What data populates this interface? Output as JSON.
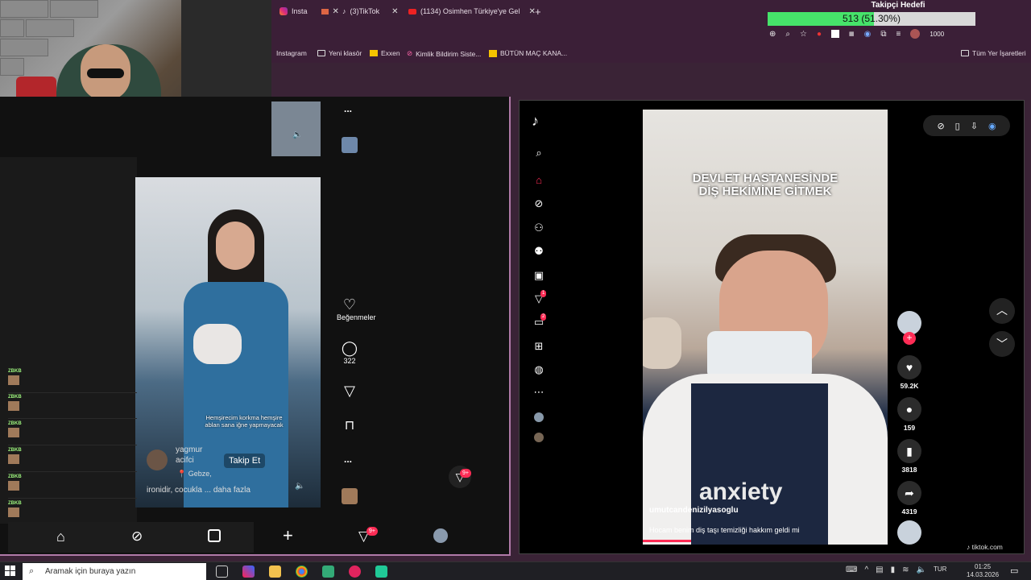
{
  "browser": {
    "tabs": [
      {
        "label": "Insta",
        "icon": "instagram-icon"
      },
      {
        "label": "(3)TikTok",
        "icon": "tiktok-icon"
      },
      {
        "label": "(1134) Osimhen Türkiye'ye Gel",
        "icon": "youtube-icon"
      }
    ],
    "new_tab": "+",
    "bookmarks": [
      "Instagram",
      "Yeni klasör",
      "Exxen",
      "Kimlik Bildirim Siste...",
      "BÜTÜN MAÇ KANA..."
    ],
    "all_bookmarks": "Tüm Yer İşaretleri",
    "toolbar_badge": "1000"
  },
  "goal": {
    "title": "Takipçi Hedefi",
    "text": "513 (51.30%)",
    "progress": 0.513,
    "fill_color": "#46e36a"
  },
  "left_pane": {
    "likes_label": "Beğenmeler",
    "comments_count": "322",
    "caption_line1": "Hemşirecim korkma hemşire",
    "caption_line2": "ablan sana iğne yapmayacak",
    "username_line1": "yagmur",
    "username_line2": "acifci",
    "follow_label": "Takip Et",
    "location": "Gebze,",
    "description": "ironidir, cocukla ... daha fazla",
    "inbox_badge": "9+",
    "nav_inbox_badge": "9+",
    "chat_name": "ZBKB",
    "menu_dots": "..."
  },
  "right_pane": {
    "video_title_line1": "DEVLET HASTANESİNDE",
    "video_title_line2": "DİŞ HEKİMİNE GİTMEK",
    "shirt_text": "anxiety",
    "username": "umutcandenizilyasoglu",
    "caption": "Hocam benim diş taşı temizliği hakkım geldi mi",
    "likes": "59.2K",
    "comments": "159",
    "saves": "3818",
    "shares": "4319",
    "messages_badge": "1",
    "activity_badge": "2",
    "watermark": "tiktok.com"
  },
  "taskbar": {
    "search_placeholder": "Aramak için buraya yazın",
    "language": "TUR",
    "time": "01:25",
    "date": "14.03.2026"
  }
}
